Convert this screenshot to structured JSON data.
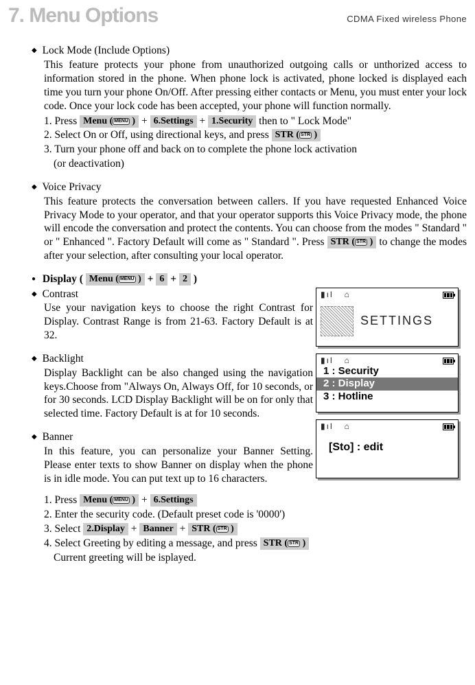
{
  "header": {
    "title": "7. Menu Options",
    "subtitle": "CDMA Fixed wireless Phone"
  },
  "keys": {
    "menu": "Menu (       )",
    "menu_sm": "MENU",
    "str": "STR (       )",
    "str_sm": "STR",
    "six_settings": "6.Settings",
    "one_security": "1.Security",
    "six": "6",
    "two": "2",
    "two_display": "2.Display",
    "banner": "Banner"
  },
  "lock": {
    "title": "Lock Mode (Include Options)",
    "body": "This feature protects your phone from unauthorized outgoing calls or unthorized access to information stored in the phone.  When phone lock is activated, phone locked is displayed each time you turn your phone On/Off. After pressing either contacts or Menu, you must enter your lock code. Once your lock code has been accepted, your phone will function normally.",
    "s1a": "1. Press ",
    "s1b": " + ",
    "s1c": " + ",
    "s1d": "  then to \" Lock Mode\"",
    "s2a": "2. Select On or Off, using directional keys, and press ",
    "s3": "3. Turn your phone off and back on to complete the phone lock activation",
    "s3b": "(or deactivation)"
  },
  "voice": {
    "title": "Voice Privacy",
    "body_a": "This feature protects the conversation between callers. If you have requested Enhanced Voice Privacy Mode to your operator, and that your operator supports this Voice Privacy mode, the phone will encode the conversation and protect the contents. You can choose from the modes \" Standard \" or \" Enhanced \". Factory Default will come as \" Standard \". Press ",
    "body_b": "  to change the modes after your selection, after consulting your local operator."
  },
  "display_line": {
    "label_a": "Display (  ",
    "label_b": "  +  ",
    "label_c": "  +  ",
    "label_d": "   )"
  },
  "contrast": {
    "title": "Contrast",
    "body": "Use your navigation keys  to choose the right Contrast for Display. Contrast Range  is from 21-63. Factory Default is at 32."
  },
  "backlight": {
    "title": "Backlight",
    "body": "Display Backlight can be also changed using the navigation keys.Choose from \"Always On, Always Off, for 10 seconds, or for 30 seconds. LCD Display Backlight  will be on for only that selected time. Factory Default is at for 10 seconds."
  },
  "banner": {
    "title": "Banner",
    "body": "In this feature, you can personalize your Banner Setting. Please enter texts to show Banner on display when the phone is in idle mode. You can put text up to 16 characters.",
    "s1a": "1. Press ",
    "s1b": "  + ",
    "s2": "2. Enter the security code. (Default preset code is '0000')",
    "s3a": "3. Select  ",
    "s3b": " +  ",
    "s3c": "   + ",
    "s4a": "4. Select Greeting by editing a message, and press ",
    "s4b": "Current greeting will be isplayed."
  },
  "screens": {
    "settings_label": "SETTINGS",
    "menu1": "1 : Security",
    "menu2": "2 : Display",
    "menu3": "3 : Hotline",
    "sto": "[Sto] : edit"
  }
}
